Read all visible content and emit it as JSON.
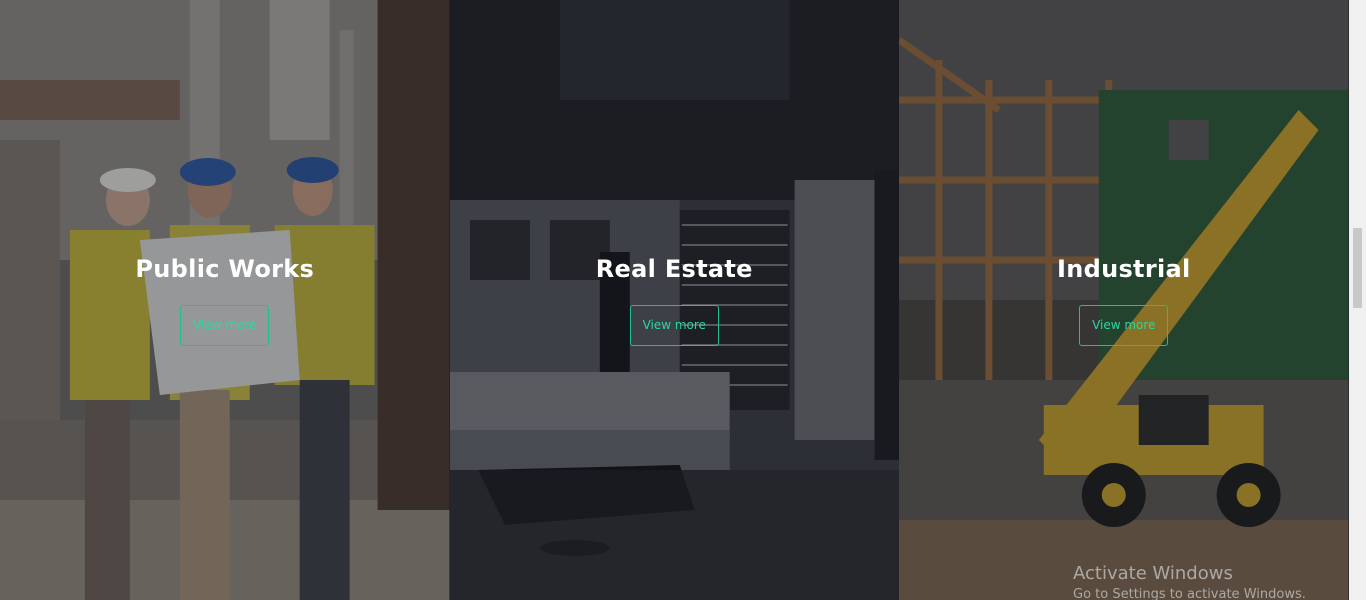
{
  "panels": [
    {
      "title": "Public Works",
      "button_label": "View more"
    },
    {
      "title": "Real Estate",
      "button_label": "View more"
    },
    {
      "title": "Industrial",
      "button_label": "View more"
    }
  ],
  "watermark": {
    "title": "Activate Windows",
    "subtitle": "Go to Settings to activate Windows."
  },
  "colors": {
    "accent": "#1fbf8f",
    "heading": "#ffffff"
  }
}
